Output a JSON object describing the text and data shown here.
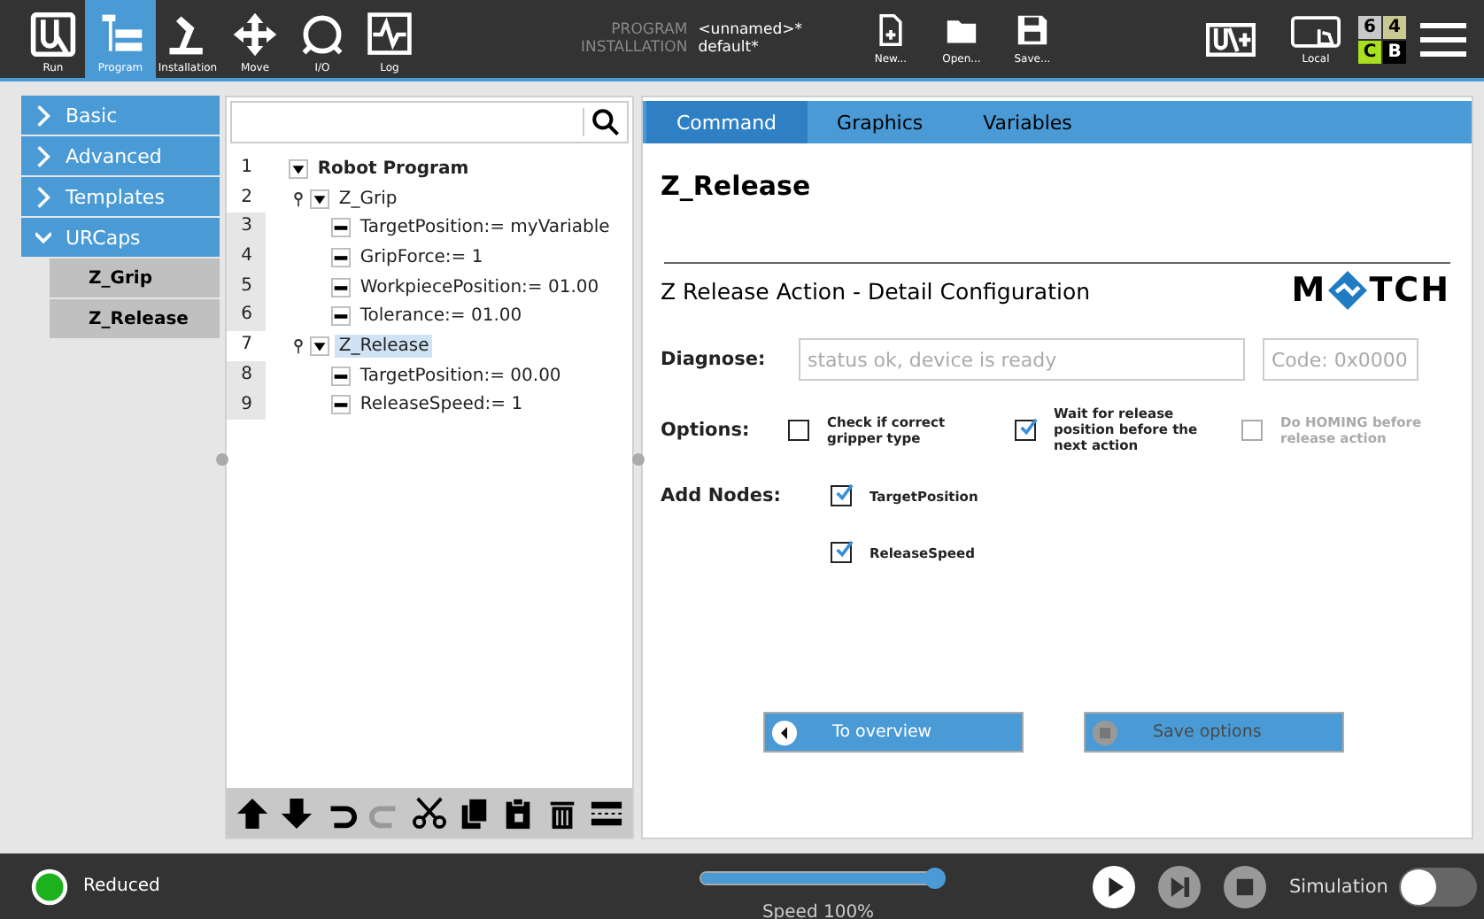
{
  "top_nav": [
    {
      "label": "Run",
      "kind": "run",
      "selected": false
    },
    {
      "label": "Program",
      "kind": "program",
      "selected": true
    },
    {
      "label": "Installation",
      "kind": "installation",
      "selected": false
    },
    {
      "label": "Move",
      "kind": "move",
      "selected": false
    },
    {
      "label": "I/O",
      "kind": "io",
      "selected": false
    },
    {
      "label": "Log",
      "kind": "log",
      "selected": false
    }
  ],
  "program": {
    "label": "PROGRAM",
    "value": "<unnamed>*"
  },
  "installation": {
    "label": "INSTALLATION",
    "value": "default*"
  },
  "file_buttons": [
    {
      "label": "New...",
      "kind": "new"
    },
    {
      "label": "Open...",
      "kind": "open"
    },
    {
      "label": "Save...",
      "kind": "save"
    }
  ],
  "local": {
    "label": "Local"
  },
  "status_grid": [
    {
      "text": "6",
      "color": "#c8c8c8"
    },
    {
      "text": "4",
      "color": "#c8c890"
    },
    {
      "text": "C",
      "color": "#a8e020"
    },
    {
      "text": "B",
      "color": "#000000"
    }
  ],
  "sidebar": [
    {
      "label": "Basic",
      "expanded": false
    },
    {
      "label": "Advanced",
      "expanded": false
    },
    {
      "label": "Templates",
      "expanded": false
    },
    {
      "label": "URCaps",
      "expanded": true,
      "children": [
        {
          "label": "Z_Grip"
        },
        {
          "label": "Z_Release"
        }
      ]
    }
  ],
  "tree": [
    {
      "number": "1",
      "text": "Robot Program",
      "kind": "root",
      "selected": false,
      "children": [
        {
          "number": "2",
          "text": "Z_Grip",
          "kind": "node",
          "selected": false,
          "children": [
            {
              "number": "3",
              "text": "TargetPosition:= myVariable",
              "kind": "leaf",
              "selected": false
            },
            {
              "number": "4",
              "text": "GripForce:= 1",
              "kind": "leaf",
              "selected": false
            },
            {
              "number": "5",
              "text": "WorkpiecePosition:= 01.00",
              "kind": "leaf",
              "selected": false
            },
            {
              "number": "6",
              "text": "Tolerance:= 01.00",
              "kind": "leaf",
              "selected": false
            }
          ]
        },
        {
          "number": "7",
          "text": "Z_Release",
          "kind": "node",
          "selected": true,
          "children": [
            {
              "number": "8",
              "text": "TargetPosition:= 00.00",
              "kind": "leaf",
              "selected": false
            },
            {
              "number": "9",
              "text": "ReleaseSpeed:= 1",
              "kind": "leaf",
              "selected": false
            }
          ]
        }
      ]
    }
  ],
  "tree_toolbar": [
    {
      "kind": "up",
      "disabled": false
    },
    {
      "kind": "down",
      "disabled": false
    },
    {
      "kind": "undo",
      "disabled": false
    },
    {
      "kind": "redo",
      "disabled": true
    },
    {
      "kind": "cut",
      "disabled": false
    },
    {
      "kind": "copy",
      "disabled": false
    },
    {
      "kind": "paste",
      "disabled": false
    },
    {
      "kind": "delete",
      "disabled": false
    },
    {
      "kind": "suppress",
      "disabled": false
    }
  ],
  "tabs": [
    {
      "label": "Command",
      "selected": true
    },
    {
      "label": "Graphics",
      "selected": false
    },
    {
      "label": "Variables",
      "selected": false
    }
  ],
  "node_title": "Z_Release",
  "heading": "Z Release Action - Detail Configuration",
  "logo": {
    "left": "M",
    "right": "TCH"
  },
  "diagnose": {
    "label": "Diagnose:",
    "status": "status ok, device is ready",
    "code": "Code: 0x0000"
  },
  "options": {
    "label": "Options:",
    "items": [
      {
        "label": "Check if correct gripper type",
        "checked": false,
        "disabled": false
      },
      {
        "label": "Wait for release position before the next action",
        "checked": true,
        "disabled": false
      },
      {
        "label": "Do HOMING before release action",
        "checked": false,
        "disabled": true
      }
    ]
  },
  "add_nodes": {
    "label": "Add Nodes:",
    "items": [
      {
        "label": "TargetPosition",
        "checked": true
      },
      {
        "label": "ReleaseSpeed",
        "checked": true
      }
    ]
  },
  "actions": [
    {
      "label": "To overview",
      "kind": "back",
      "disabled": false
    },
    {
      "label": "Save options",
      "kind": "save",
      "disabled": true
    }
  ],
  "footer": {
    "mode": "Reduced",
    "speed": {
      "level": 1.0,
      "reading": "Speed 100%"
    },
    "simulation": {
      "label": "Simulation",
      "on": false
    }
  }
}
